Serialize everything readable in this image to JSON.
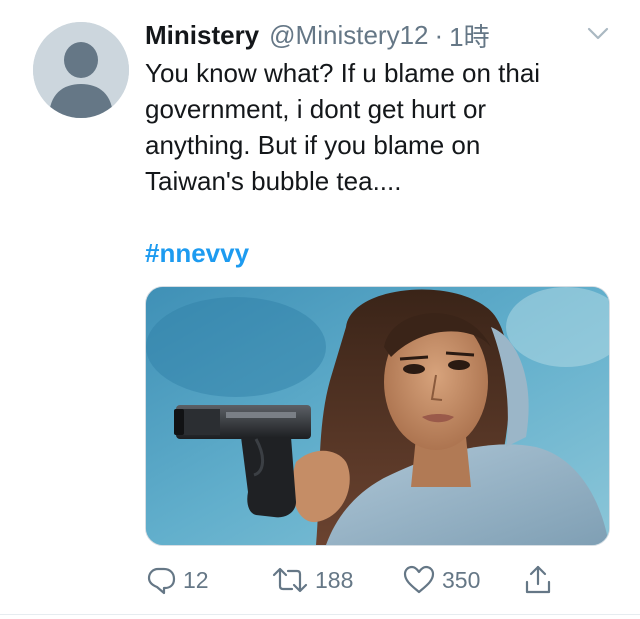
{
  "tweet": {
    "author": {
      "display_name": "Ministery",
      "handle": "@Ministery12",
      "avatar_icon": "default-profile-icon"
    },
    "separator": "·",
    "time": "1時",
    "menu_icon": "chevron-down-icon",
    "text_lines": [
      "You know what? If u blame on thai",
      "government, i dont get hurt or",
      "anything. But if you blame on",
      "Taiwan's bubble tea...."
    ],
    "hashtag": "#nnevvy",
    "media": {
      "kind": "photo",
      "alt_icon": "photo-image"
    },
    "actions": {
      "reply": {
        "icon": "reply-icon",
        "count": "12"
      },
      "retweet": {
        "icon": "retweet-icon",
        "count": "188"
      },
      "like": {
        "icon": "heart-icon",
        "count": "350"
      },
      "share": {
        "icon": "share-icon"
      }
    }
  },
  "colors": {
    "text": "#14171a",
    "secondary": "#657786",
    "link": "#1d9bf0",
    "avatar_bg": "#ccd6dd",
    "avatar_fg": "#657786"
  }
}
